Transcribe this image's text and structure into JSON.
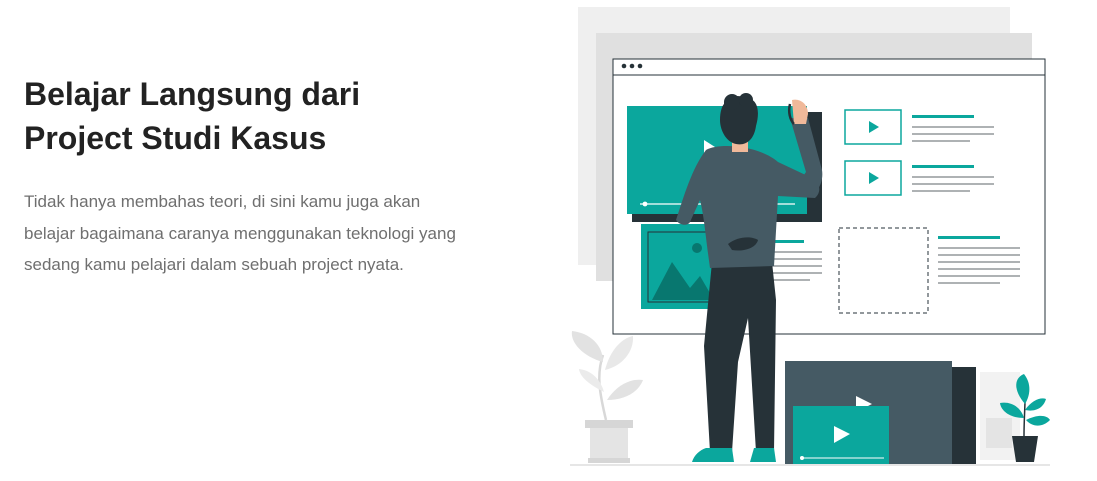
{
  "section": {
    "title_line1": "Belajar Langsung dari",
    "title_line2": "Project Studi Kasus",
    "description": "Tidak hanya membahas teori, di sini kamu juga akan belajar bagaimana caranya menggunakan teknologi yang sedang kamu pelajari dalam sebuah project nyata."
  },
  "illustration": {
    "accent_color": "#0ba79d",
    "dark_color": "#263238",
    "shirt_color": "#455a64",
    "background_panel_color": "#ebebeb",
    "icons": [
      "browser-window",
      "video-play-icon",
      "image-placeholder-icon",
      "plant-pot-icon"
    ]
  }
}
